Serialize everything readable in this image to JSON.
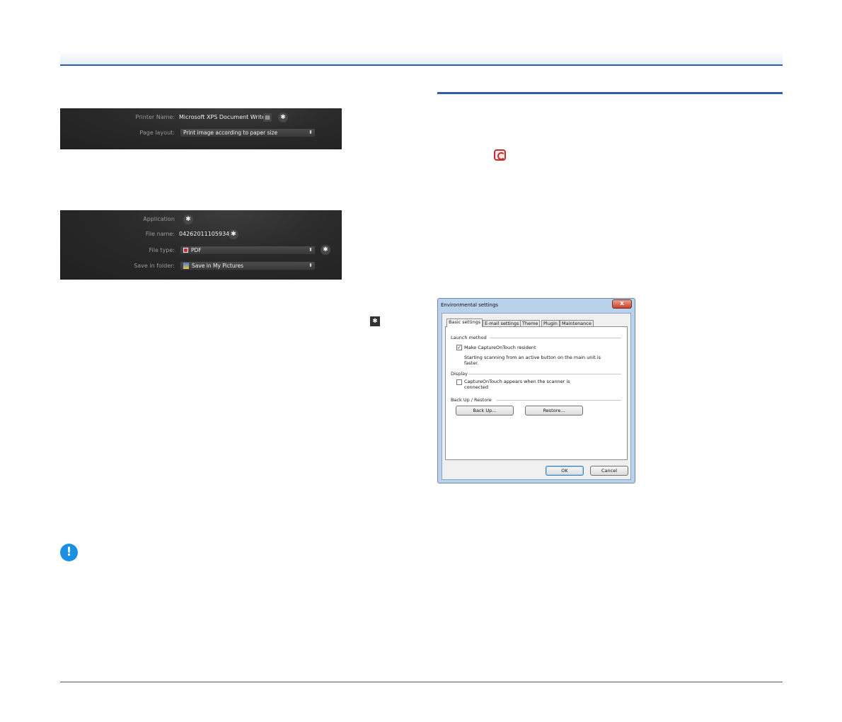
{
  "printer_panel": {
    "printer_name_label": "Printer Name:",
    "printer_name_value": "Microsoft XPS Document Writer",
    "page_layout_label": "Page layout:",
    "page_layout_value": "Print image according to paper size"
  },
  "save_panel": {
    "application_label": "Application",
    "file_name_label": "File name:",
    "file_name_value": "04262011105934",
    "file_type_label": "File type:",
    "file_type_value": "PDF",
    "save_folder_label": "Save in folder:",
    "save_folder_value": "Save in My Pictures"
  },
  "icons": {
    "gear": "✱",
    "chevrons": "⬍",
    "printer_properties": "▤",
    "caution": "!"
  },
  "dialog": {
    "title": "Environmental settings",
    "close": "x",
    "tabs": [
      "Basic settings",
      "E-mail settings",
      "Theme",
      "Plugin",
      "Maintenance"
    ],
    "launch_method_label": "Launch method",
    "make_resident_label": "Make CaptureOnTouch resident",
    "make_resident_checked": "✓",
    "resident_description": "Starting scanning from an active button on the main unit is faster.",
    "display_label": "Display",
    "appears_label": "CaptureOnTouch appears when the scanner is connected",
    "backup_restore_label": "Back Up / Restore",
    "backup_button": "Back Up...",
    "restore_button": "Restore...",
    "ok_button": "OK",
    "cancel_button": "Cancel"
  },
  "colors": {
    "accent_blue": "#2e5fa6",
    "caution_blue": "#1a8fe3",
    "panel_dark": "#2a2a2a"
  }
}
